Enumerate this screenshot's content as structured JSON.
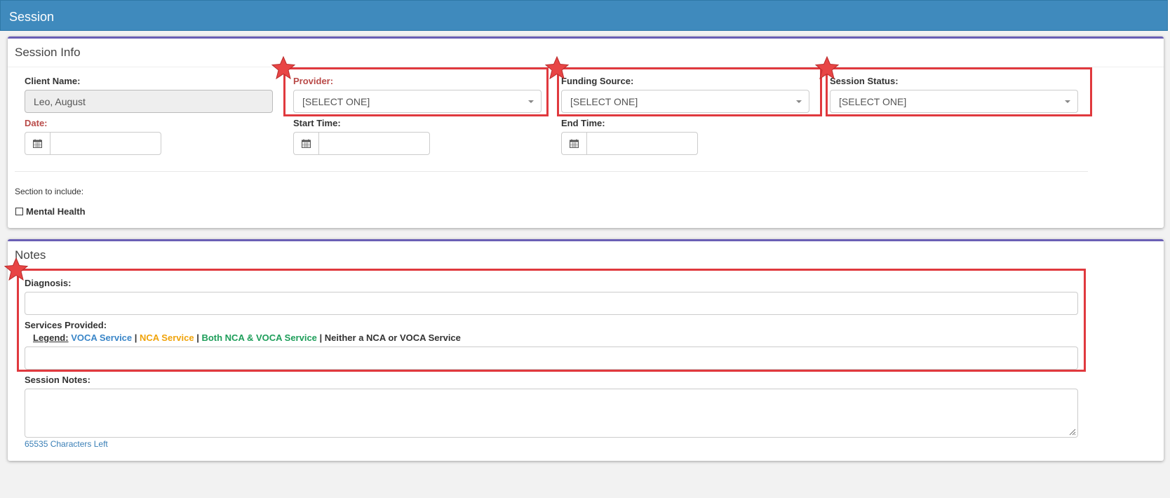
{
  "header": {
    "title": "Session"
  },
  "session_info": {
    "title": "Session Info",
    "client_name_label": "Client Name:",
    "client_name_value": "Leo, August",
    "provider_label": "Provider:",
    "provider_value": "[SELECT ONE]",
    "funding_label": "Funding Source:",
    "funding_value": "[SELECT ONE]",
    "status_label": "Session Status:",
    "status_value": "[SELECT ONE]",
    "date_label": "Date:",
    "start_time_label": "Start Time:",
    "end_time_label": "End Time:",
    "section_include_label": "Section to include:",
    "mental_health_label": "Mental Health"
  },
  "notes": {
    "title": "Notes",
    "diagnosis_label": "Diagnosis:",
    "services_label": "Services Provided:",
    "legend": {
      "label": "Legend:",
      "voca": "VOCA Service",
      "nca": "NCA Service",
      "both": "Both NCA & VOCA Service",
      "neither": "Neither a NCA or VOCA Service",
      "separator": " | "
    },
    "session_notes_label": "Session Notes:",
    "chars_left": "65535 Characters Left"
  },
  "colors": {
    "header_bg": "#3f8abd",
    "required_label": "#b94a48",
    "voca": "#3a86c8",
    "nca": "#f0a30a",
    "both": "#1e9e5a",
    "highlight": "#e0393e",
    "star": "#e84545"
  },
  "icons": {
    "calendar": "calendar-icon",
    "caret": "caret-down-icon",
    "checkbox": "checkbox-icon",
    "star": "star-icon",
    "resize": "resize-grip-icon"
  }
}
